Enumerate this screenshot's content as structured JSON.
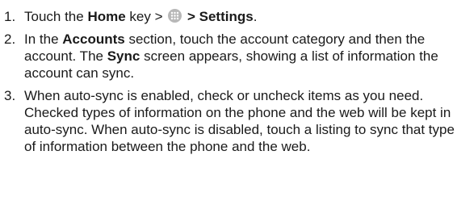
{
  "steps": [
    {
      "number": "1.",
      "parts": {
        "t1": "Touch the ",
        "b1": "Home",
        "t2": " key > ",
        "icon": "apps-launcher-icon",
        "t3": " > ",
        "b2": "Settings",
        "t4": "."
      }
    },
    {
      "number": "2.",
      "parts": {
        "t1": "In the ",
        "b1": "Accounts",
        "t2": " section, touch the account category and then the account. The ",
        "b2": "Sync",
        "t3": " screen appears, showing a list of information the account can sync."
      }
    },
    {
      "number": "3.",
      "text": "When auto-sync is enabled, check or uncheck items as you need. Checked types of information on the phone and the web will be kept in auto-sync. When auto-sync is disabled, touch a listing to sync that type of information between the phone and the web."
    }
  ]
}
